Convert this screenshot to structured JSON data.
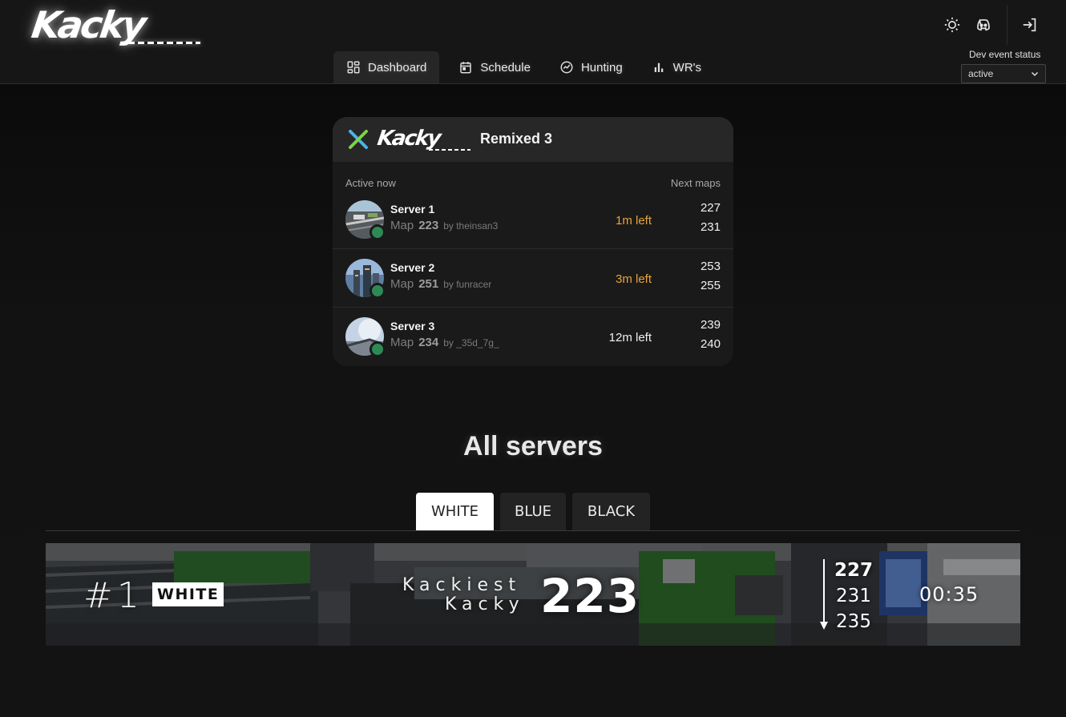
{
  "header": {
    "logo_text": "Kacky",
    "nav": [
      {
        "label": "Dashboard",
        "icon": "dashboard-icon",
        "active": true
      },
      {
        "label": "Schedule",
        "icon": "calendar-icon",
        "active": false
      },
      {
        "label": "Hunting",
        "icon": "trend-icon",
        "active": false
      },
      {
        "label": "WR's",
        "icon": "bar-chart-icon",
        "active": false
      }
    ],
    "icons": [
      "sun-icon",
      "discord-icon",
      "login-icon"
    ],
    "dev_status_label": "Dev event status",
    "dev_status_value": "active"
  },
  "event_card": {
    "logo_text": "Kacky",
    "title": "Remixed 3",
    "col_active": "Active now",
    "col_next": "Next maps",
    "servers": [
      {
        "name": "Server 1",
        "map_label": "Map",
        "map": "223",
        "author": "by theinsan3",
        "time_left": "1m left",
        "time_color": "#e8a33a",
        "next": [
          "227",
          "231"
        ]
      },
      {
        "name": "Server 2",
        "map_label": "Map",
        "map": "251",
        "author": "by funracer",
        "time_left": "3m left",
        "time_color": "#e8a33a",
        "next": [
          "253",
          "255"
        ]
      },
      {
        "name": "Server 3",
        "map_label": "Map",
        "map": "234",
        "author": "by _35d_7g_",
        "time_left": "12m left",
        "time_color": "#f0f0f0",
        "next": [
          "239",
          "240"
        ]
      }
    ]
  },
  "all_servers": {
    "title": "All servers",
    "tabs": [
      "WHITE",
      "BLUE",
      "BLACK"
    ],
    "selected_tab": "WHITE"
  },
  "banner": {
    "rank": "#1",
    "tag": "WHITE",
    "line1": "Kackiest",
    "line2": "Kacky",
    "map": "223",
    "next": [
      "227",
      "231",
      "235"
    ],
    "timer": "00:35"
  },
  "colors": {
    "accent_orange": "#e8a33a",
    "online_green": "#2e8a55",
    "background": "#131313"
  }
}
